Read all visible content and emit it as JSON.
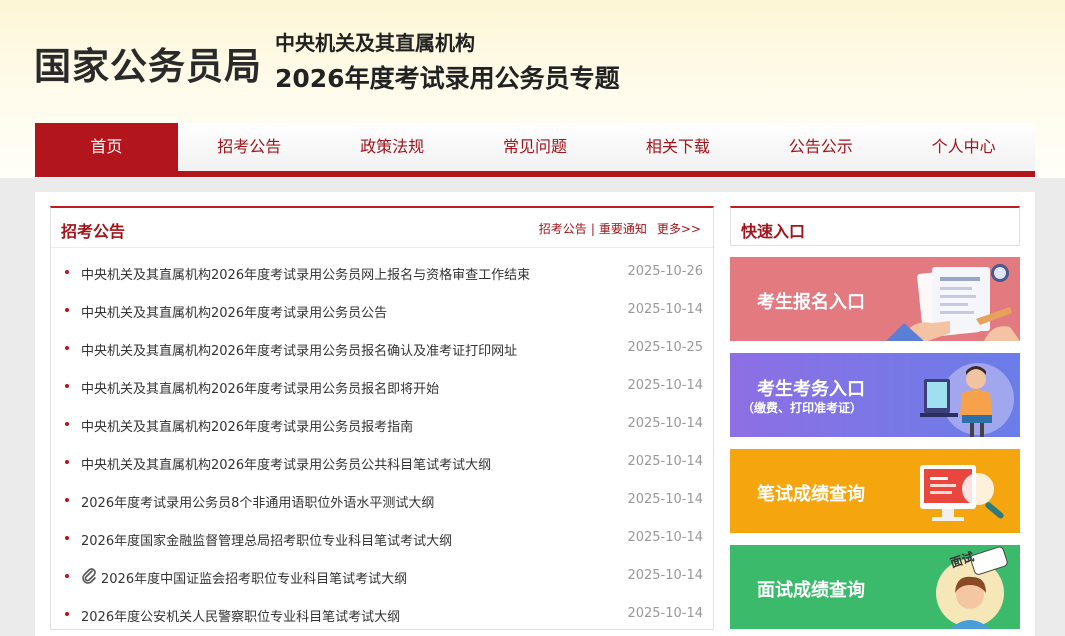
{
  "header": {
    "site_title": "国家公务员局",
    "subtitle_line1": "中央机关及其直属机构",
    "subtitle_line2": "2026年度考试录用公务员专题"
  },
  "nav": {
    "items": [
      "首页",
      "招考公告",
      "政策法规",
      "常见问题",
      "相关下载",
      "公告公示",
      "个人中心"
    ],
    "active": "首页"
  },
  "news": {
    "title": "招考公告",
    "links": {
      "announce": "招考公告",
      "separator": "|",
      "notice": "重要通知",
      "more": "更多>>"
    },
    "items": [
      {
        "text": "中央机关及其直属机构2026年度考试录用公务员网上报名与资格审查工作结束",
        "date": "2025-10-26"
      },
      {
        "text": "中央机关及其直属机构2026年度考试录用公务员公告",
        "date": "2025-10-14"
      },
      {
        "text": "中央机关及其直属机构2026年度考试录用公务员报名确认及准考证打印网址",
        "date": "2025-10-25"
      },
      {
        "text": "中央机关及其直属机构2026年度考试录用公务员报名即将开始",
        "date": "2025-10-14"
      },
      {
        "text": "中央机关及其直属机构2026年度考试录用公务员报考指南",
        "date": "2025-10-14"
      },
      {
        "text": "中央机关及其直属机构2026年度考试录用公务员公共科目笔试考试大纲",
        "date": "2025-10-14"
      },
      {
        "text": "2026年度考试录用公务员8个非通用语职位外语水平测试大纲",
        "date": "2025-10-14"
      },
      {
        "text": "2026年度国家金融监督管理总局招考职位专业科目笔试考试大纲",
        "date": "2025-10-14"
      },
      {
        "text": "2026年度中国证监会招考职位专业科目笔试考试大纲",
        "date": "2025-10-14",
        "icon": "paperclip-icon"
      },
      {
        "text": "2026年度公安机关人民警察职位专业科目笔试考试大纲",
        "date": "2025-10-14"
      }
    ]
  },
  "quick": {
    "title": "快速入口",
    "cards": [
      {
        "label": "考生报名入口",
        "color": "#e27a80",
        "icon": "application-form-icon"
      },
      {
        "label": "考生考务入口",
        "sub": "（缴费、打印准考证）",
        "color": "#7b74e6",
        "icon": "computer-user-icon"
      },
      {
        "label": "笔试成绩查询",
        "color": "#f5a60e",
        "icon": "monitor-search-icon"
      },
      {
        "label": "面试成绩查询",
        "color": "#3bba6c",
        "icon": "interview-person-icon",
        "bubble": "面试"
      }
    ]
  },
  "colors": {
    "brand_red": "#b3151d",
    "date_gray": "#999999"
  }
}
